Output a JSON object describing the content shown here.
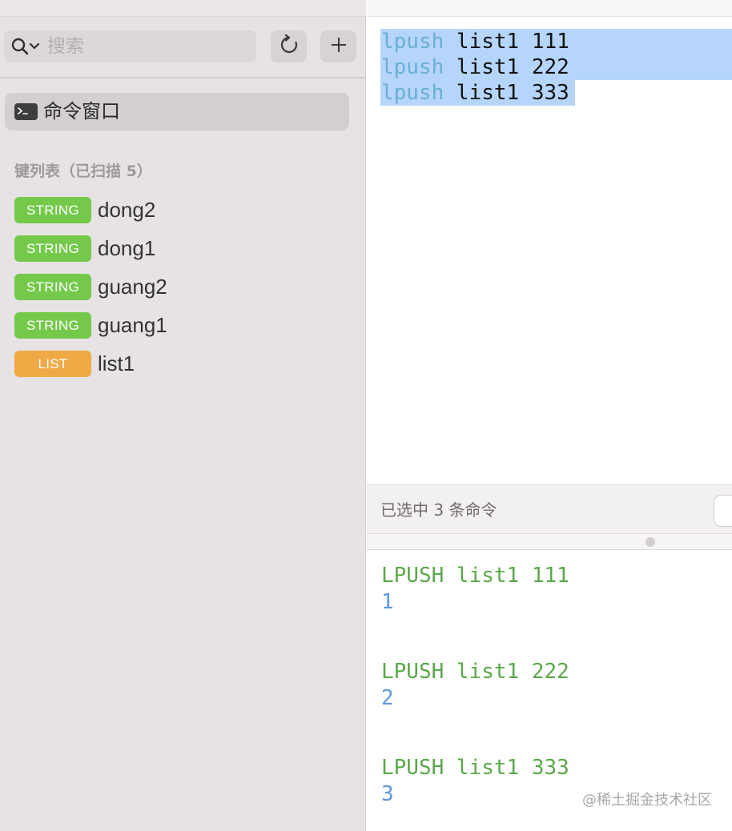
{
  "sidebar": {
    "search": {
      "placeholder": "搜索"
    },
    "command_window_label": "命令窗口",
    "keys_header": "键列表（已扫描 5）",
    "keys": [
      {
        "type": "STRING",
        "name": "dong2",
        "color": "#74c94b"
      },
      {
        "type": "STRING",
        "name": "dong1",
        "color": "#74c94b"
      },
      {
        "type": "STRING",
        "name": "guang2",
        "color": "#74c94b"
      },
      {
        "type": "STRING",
        "name": "guang1",
        "color": "#74c94b"
      },
      {
        "type": "LIST",
        "name": "list1",
        "color": "#efaa45"
      }
    ]
  },
  "editor": {
    "lines": [
      {
        "command": "lpush",
        "args": " list1 111"
      },
      {
        "command": "lpush",
        "args": " list1 222"
      },
      {
        "command": "lpush",
        "args": " list1 333"
      }
    ],
    "status_text": "已选中 3 条命令"
  },
  "results": [
    {
      "command": "LPUSH list1 111",
      "value": "1"
    },
    {
      "command": "LPUSH list1 222",
      "value": "2"
    },
    {
      "command": "LPUSH list1 333",
      "value": "3"
    }
  ],
  "watermark": "@稀土掘金技术社区",
  "colors": {
    "string_badge": "#74c94b",
    "list_badge": "#efaa45",
    "selection": "#b5d5fb",
    "keyword": "#6aaed6",
    "result_command": "#5ba84a",
    "result_value": "#5d97e0"
  },
  "icons": {
    "search": "search-icon",
    "refresh": "refresh-icon",
    "add": "plus-icon",
    "terminal": "terminal-icon"
  }
}
